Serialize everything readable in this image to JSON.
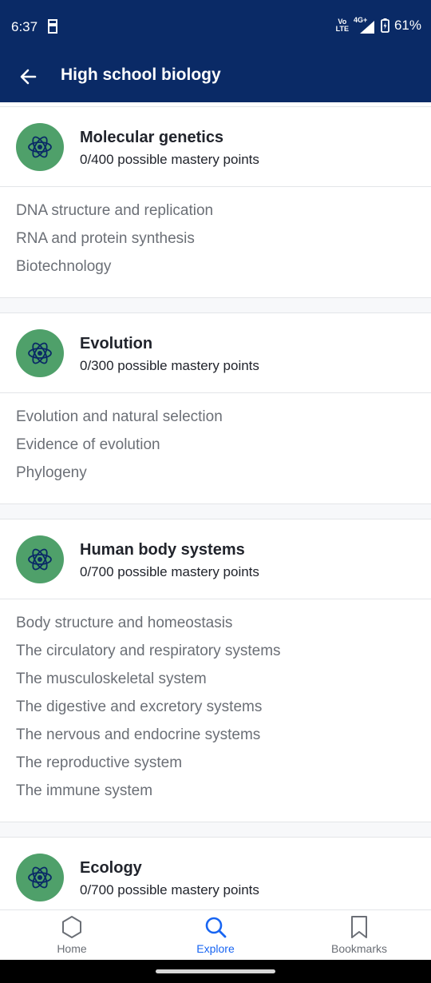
{
  "status_bar": {
    "time": "6:37",
    "network_top": "Vo",
    "network_bottom": "LTE",
    "network_type": "4G+",
    "battery": "61%"
  },
  "app_bar": {
    "title": "High school biology"
  },
  "units": [
    {
      "title": "Molecular genetics",
      "points": "0/400 possible mastery points",
      "lessons": [
        "DNA structure and replication",
        "RNA and protein synthesis",
        "Biotechnology"
      ]
    },
    {
      "title": "Evolution",
      "points": "0/300 possible mastery points",
      "lessons": [
        "Evolution and natural selection",
        "Evidence of evolution",
        "Phylogeny"
      ]
    },
    {
      "title": "Human body systems",
      "points": "0/700 possible mastery points",
      "lessons": [
        "Body structure and homeostasis",
        "The circulatory and respiratory systems",
        "The musculoskeletal system",
        "The digestive and excretory systems",
        "The nervous and endocrine systems",
        "The reproductive system",
        "The immune system"
      ]
    },
    {
      "title": "Ecology",
      "points": "0/700 possible mastery points",
      "lessons": []
    }
  ],
  "bottom_nav": {
    "home": "Home",
    "explore": "Explore",
    "bookmarks": "Bookmarks",
    "active": "explore"
  },
  "colors": {
    "header_bg": "#0a2a66",
    "unit_icon_bg": "#4fa06a",
    "accent": "#1865f2"
  }
}
